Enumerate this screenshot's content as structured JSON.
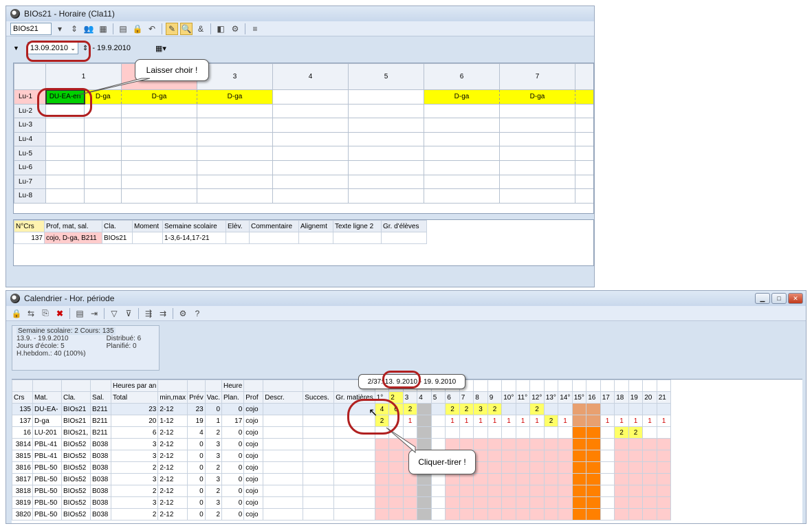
{
  "top_window": {
    "title": "BIOs21 -  Horaire  (Cla11)",
    "class_combo": "BIOs21",
    "date_from": "13.09.2010",
    "date_to": "- 19.9.2010",
    "period_headers": [
      "1",
      "2",
      "3",
      "4",
      "5",
      "6",
      "7"
    ],
    "row_labels": [
      "Lu-1",
      "Lu-2",
      "Lu-3",
      "Lu-4",
      "Lu-5",
      "Lu-6",
      "Lu-7",
      "Lu-8"
    ],
    "cells_row1": [
      "DU-EA-en",
      "D-ga",
      "D-ga",
      "D-ga",
      "",
      "",
      "D-ga",
      "D-ga"
    ],
    "detail_headers": [
      "N°Crs",
      "Prof, mat, sal.",
      "Cla.",
      "Moment",
      "Semaine scolaire",
      "Elèv.",
      "Commentaire",
      "Alignemt",
      "Texte ligne 2",
      "Gr. d'élèves"
    ],
    "detail_row": [
      "137",
      "cojo, D-ga, B211",
      "BIOs21",
      "",
      "1-3,6-14,17-21",
      "",
      "",
      "",
      "",
      ""
    ]
  },
  "callouts": {
    "drop": "Laisser choir !",
    "drag": "Cliquer-tirer !"
  },
  "bottom_window": {
    "title": "Calendrier - Hor. période",
    "info": {
      "header": "Semaine scolaire: 2  Cours: 135",
      "range": "13.9. - 19.9.2010",
      "school_days": "Jours d'école: 5",
      "weekly_hours": "H.hebdom.: 40 (100%)",
      "distributed": "Distribué: 6",
      "planned": "Planifié: 0"
    },
    "group_headers": {
      "heures": "Heures par an",
      "heure": "Heure",
      "h": "H."
    },
    "tooltip": "2/37: 13. 9.2010 - 19. 9.2010",
    "columns": [
      "Crs",
      "Mat.",
      "Cla.",
      "Sal.",
      "Total",
      "min,max",
      "Prév",
      "Vac.",
      "Plan.",
      "Prof",
      "Descr.",
      "Succes.",
      "Gr. matières"
    ],
    "weeks": [
      "1°",
      "2",
      "3",
      "4",
      "5",
      "6",
      "7",
      "8",
      "9",
      "10°",
      "11°",
      "12°",
      "13°",
      "14°",
      "15°",
      "16",
      "17",
      "18",
      "19",
      "20",
      "21"
    ],
    "rows": [
      [
        "135",
        "DU-EA-",
        "BIOs21",
        "B211",
        "23",
        "2-12",
        "23",
        "0",
        "0",
        "cojo"
      ],
      [
        "137",
        "D-ga",
        "BIOs21",
        "B211",
        "20",
        "1-12",
        "19",
        "1",
        "17",
        "cojo"
      ],
      [
        "16",
        "LU-201",
        "BIOs21,",
        "B211",
        "6",
        "2-12",
        "4",
        "2",
        "0",
        "cojo"
      ],
      [
        "3814",
        "PBL-41",
        "BIOs52",
        "B038",
        "3",
        "2-12",
        "0",
        "3",
        "0",
        "cojo"
      ],
      [
        "3815",
        "PBL-41",
        "BIOs52",
        "B038",
        "3",
        "2-12",
        "0",
        "3",
        "0",
        "cojo"
      ],
      [
        "3816",
        "PBL-50",
        "BIOs52",
        "B038",
        "2",
        "2-12",
        "0",
        "2",
        "0",
        "cojo"
      ],
      [
        "3817",
        "PBL-50",
        "BIOs52",
        "B038",
        "3",
        "2-12",
        "0",
        "3",
        "0",
        "cojo"
      ],
      [
        "3818",
        "PBL-50",
        "BIOs52",
        "B038",
        "2",
        "2-12",
        "0",
        "2",
        "0",
        "cojo"
      ],
      [
        "3819",
        "PBL-50",
        "BIOs52",
        "B038",
        "3",
        "2-12",
        "0",
        "3",
        "0",
        "cojo"
      ],
      [
        "3820",
        "PBL-50",
        "BIOs52",
        "B038",
        "2",
        "2-12",
        "0",
        "2",
        "0",
        "cojo"
      ]
    ],
    "row135_weeks": [
      "4",
      "6",
      "2",
      "",
      "",
      "2",
      "2",
      "3",
      "2",
      "",
      "",
      "2",
      "",
      "",
      "",
      "",
      "",
      "",
      "",
      "",
      ""
    ],
    "row137_weeks": [
      "2",
      "",
      "1",
      "",
      "",
      "1",
      "1",
      "1",
      "1",
      "1",
      "1",
      "1",
      "2",
      "1",
      "",
      "",
      "1",
      "1",
      "1",
      "1",
      "1"
    ],
    "row16_weeks": [
      "",
      "",
      "",
      "",
      "",
      "",
      "",
      "",
      "",
      "",
      "",
      "",
      "",
      "",
      "",
      "",
      "",
      "2",
      "2",
      "",
      ""
    ]
  }
}
